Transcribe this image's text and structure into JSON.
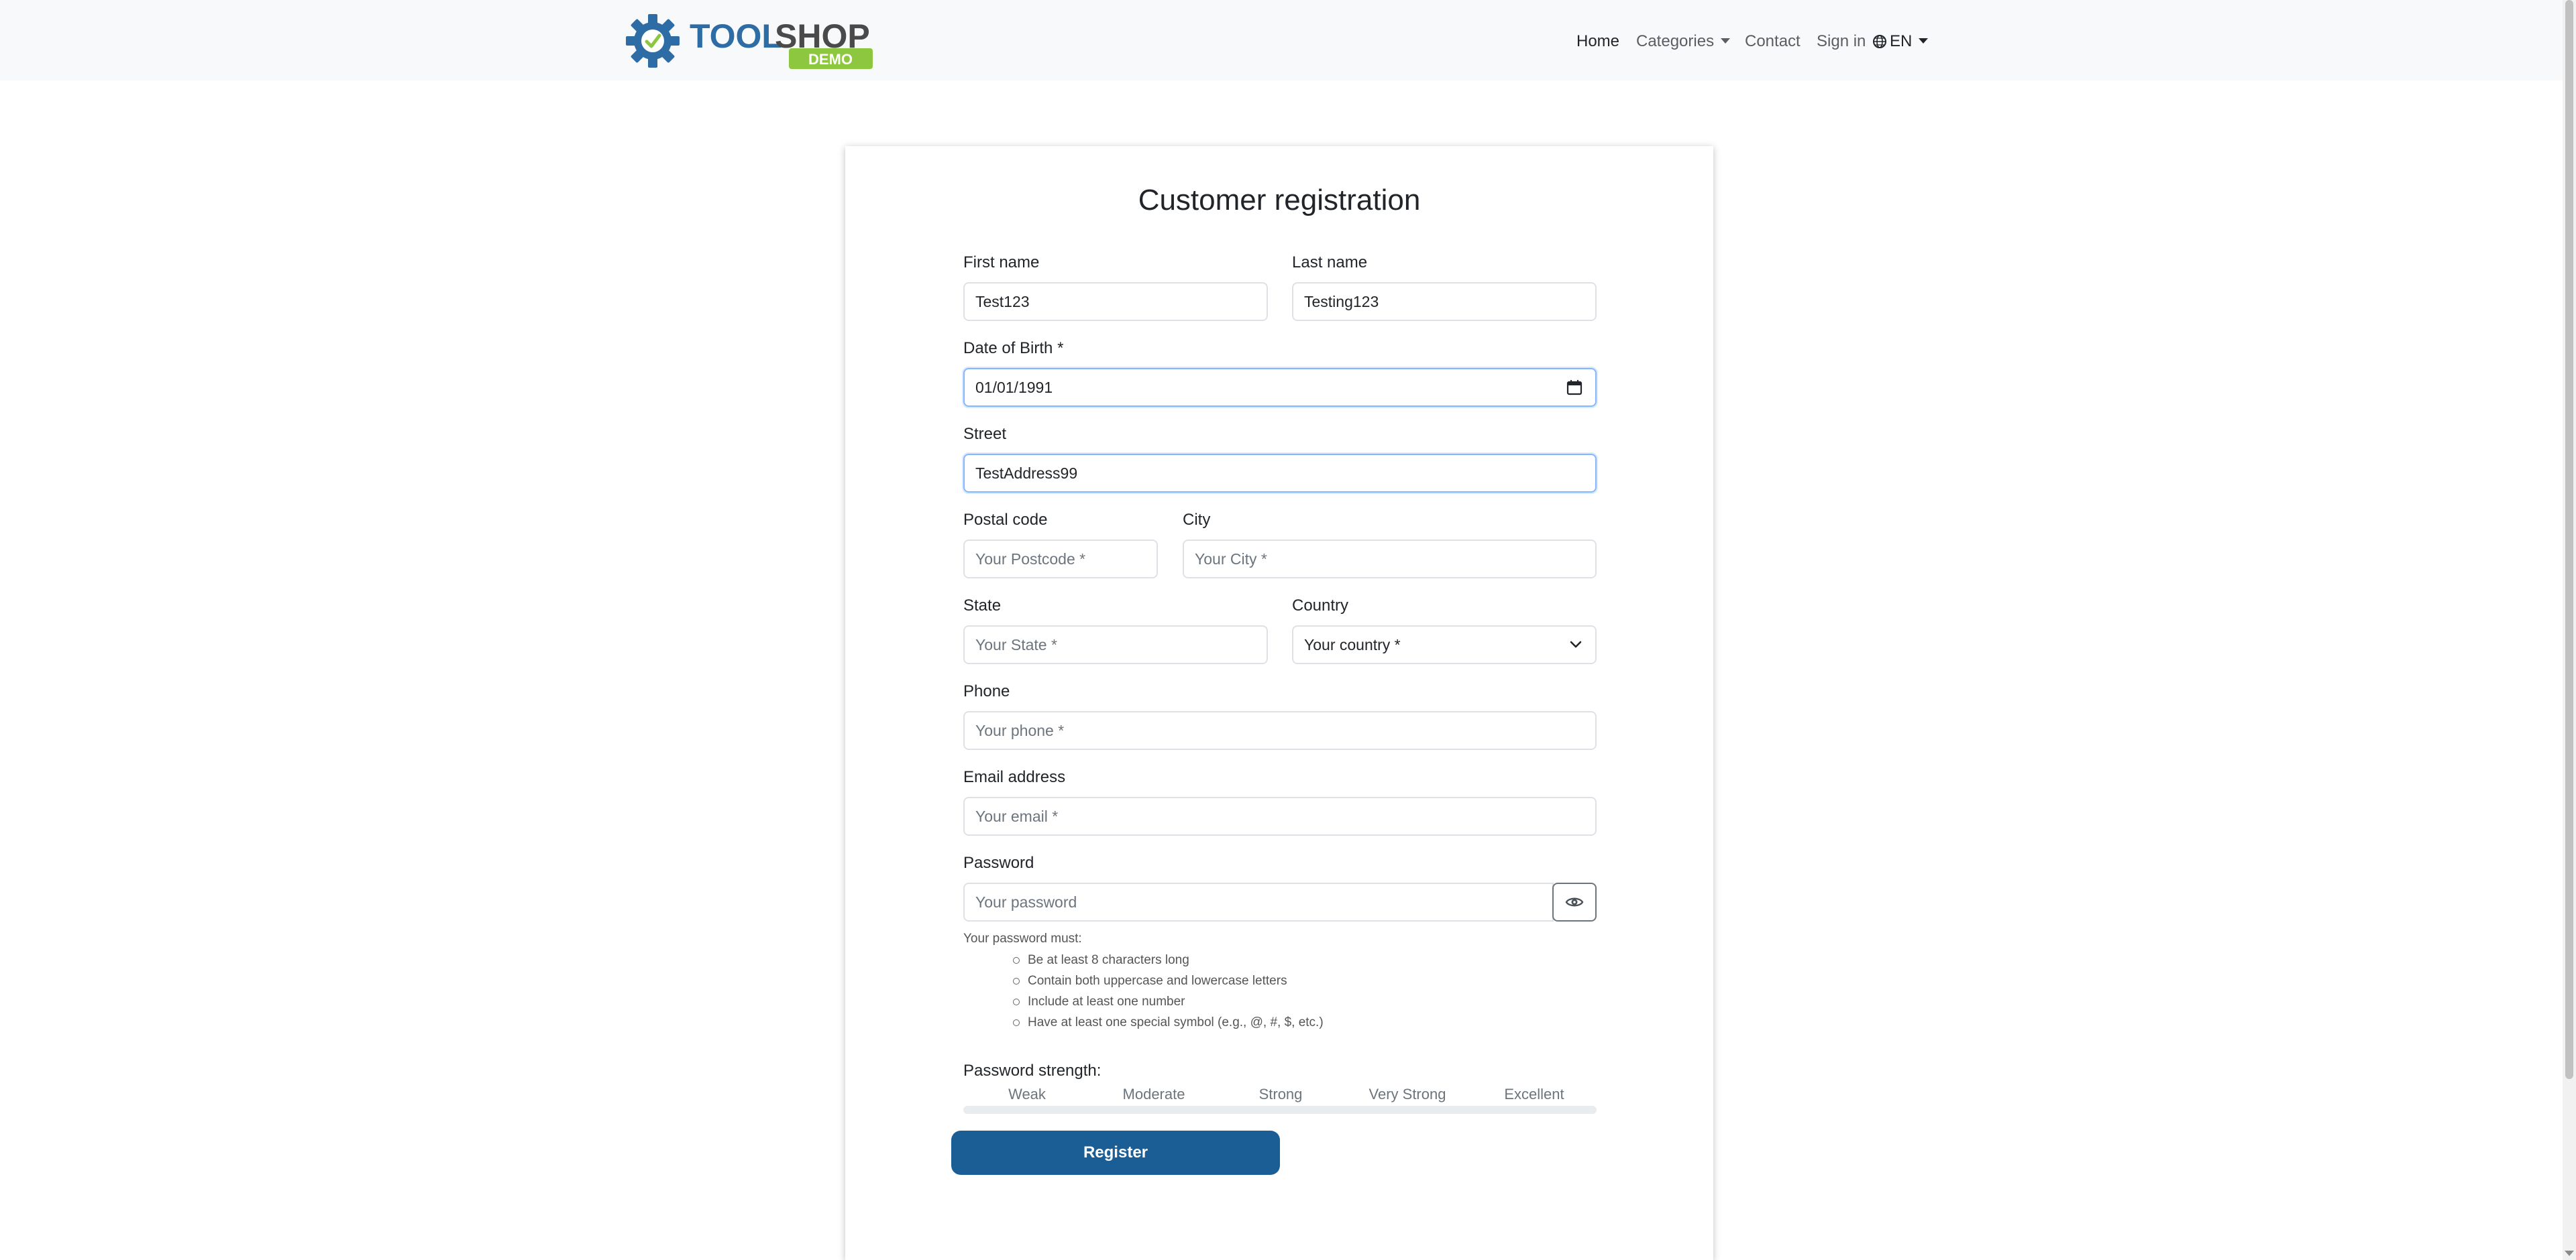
{
  "brand": {
    "name_tool": "TOOL",
    "name_shop": "SHOP",
    "badge": "DEMO",
    "colors": {
      "gear": "#2d6ca5",
      "tool": "#2d6ca5",
      "shop": "#4a4a4a",
      "badge": "#8dc63f"
    }
  },
  "nav": {
    "home": "Home",
    "categories": "Categories",
    "contact": "Contact",
    "sign_in": "Sign in",
    "language": "EN"
  },
  "form": {
    "title": "Customer registration",
    "first_name": {
      "label": "First name",
      "value": "Test123"
    },
    "last_name": {
      "label": "Last name",
      "value": "Testing123"
    },
    "dob": {
      "label": "Date of Birth *",
      "value": "01/01/1991"
    },
    "street": {
      "label": "Street",
      "value": "TestAddress99"
    },
    "postal_code": {
      "label": "Postal code",
      "placeholder": "Your Postcode *"
    },
    "city": {
      "label": "City",
      "placeholder": "Your City *"
    },
    "state": {
      "label": "State",
      "placeholder": "Your State *"
    },
    "country": {
      "label": "Country",
      "selected": "Your country *"
    },
    "phone": {
      "label": "Phone",
      "placeholder": "Your phone *"
    },
    "email": {
      "label": "Email address",
      "placeholder": "Your email *"
    },
    "password": {
      "label": "Password",
      "placeholder": "Your password"
    },
    "password_rules_intro": "Your password must:",
    "password_rules": [
      "Be at least 8 characters long",
      "Contain both uppercase and lowercase letters",
      "Include at least one number",
      "Have at least one special symbol (e.g., @, #, $, etc.)"
    ],
    "strength": {
      "label": "Password strength:",
      "levels": [
        "Weak",
        "Moderate",
        "Strong",
        "Very Strong",
        "Excellent"
      ],
      "value_percent": 0
    },
    "register_label": "Register"
  },
  "colors": {
    "accent": "#1b5e96",
    "focus_border": "#86b7fe",
    "input_border": "#dee2e6",
    "navbar_bg": "#f8f9fa"
  }
}
